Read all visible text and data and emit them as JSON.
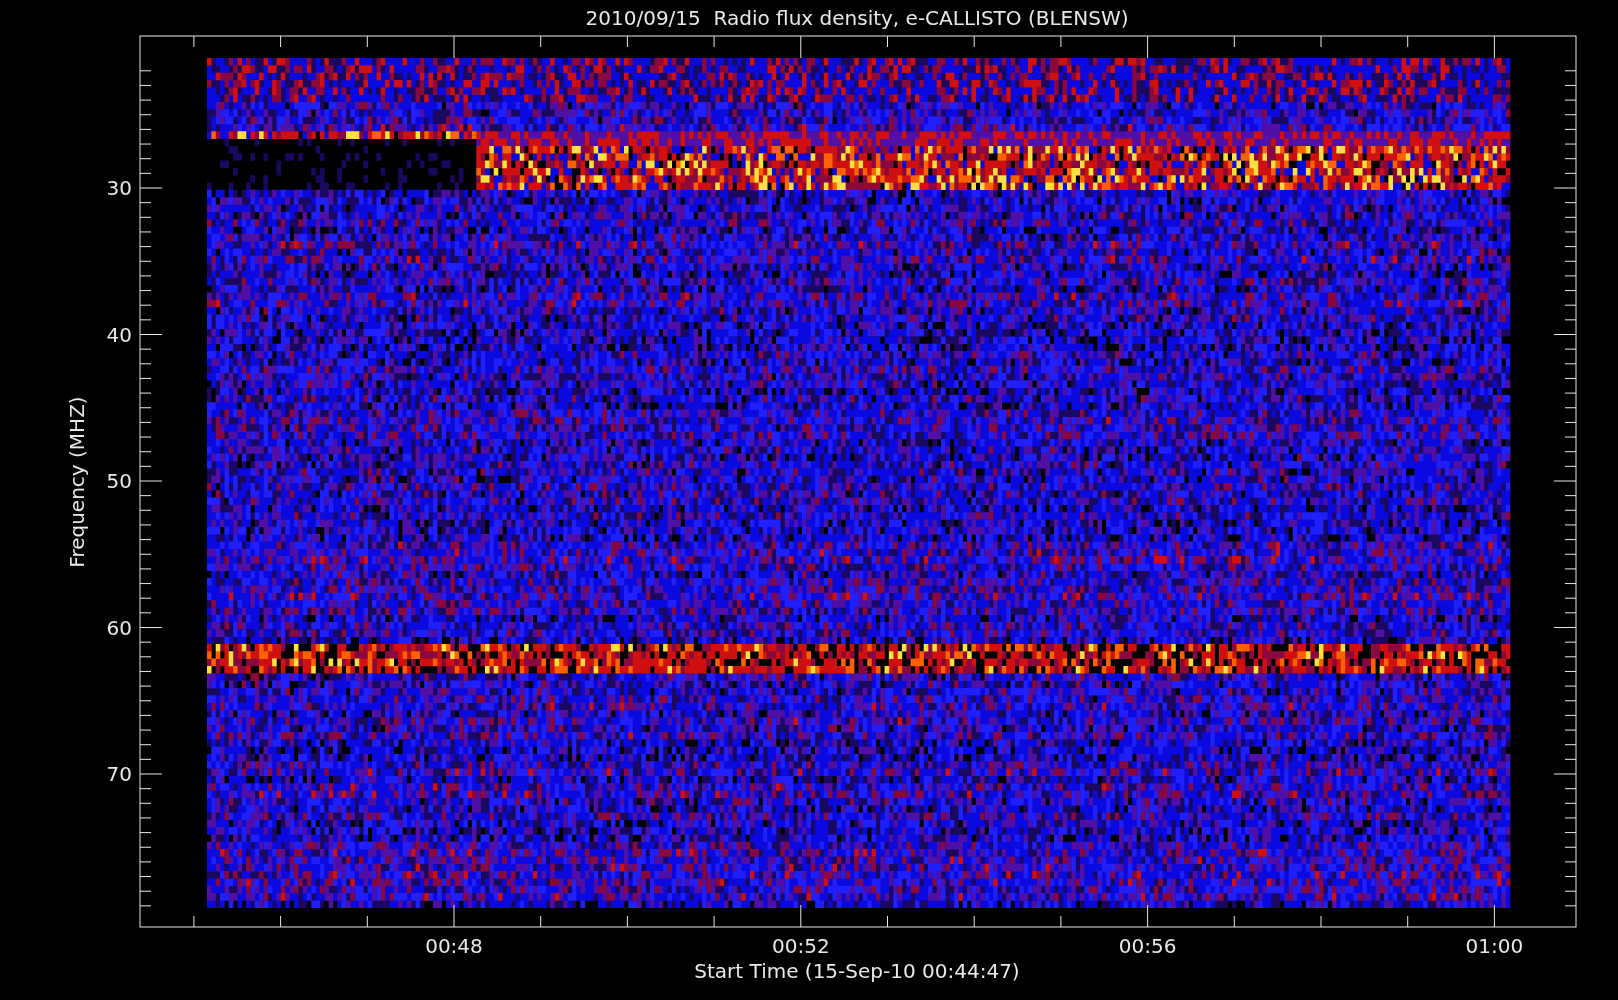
{
  "title": "2010/09/15  Radio flux density, e-CALLISTO (BLENSW)",
  "plot": {
    "ylabel": "Frequency (MHZ)",
    "xlabel": "Start Time (15-Sep-10 00:44:47)",
    "yticks": [
      "30",
      "40",
      "50",
      "60",
      "70"
    ],
    "xticks": [
      "00:48",
      "00:52",
      "00:56",
      "01:00"
    ]
  }
}
